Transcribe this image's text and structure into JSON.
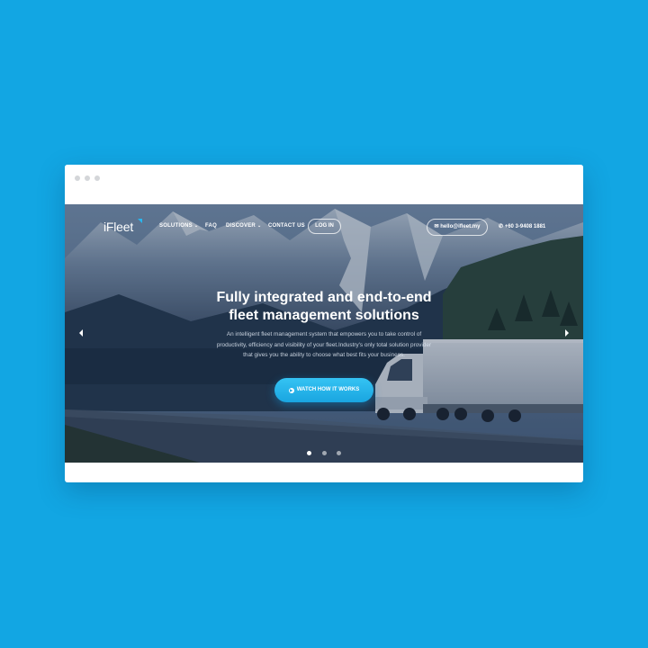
{
  "brand": {
    "logo_text": "iFleet",
    "accent_color": "#28b6f0",
    "background_color": "#12a6e3"
  },
  "nav": {
    "items": [
      {
        "label": "SOLUTIONS",
        "has_dropdown": true
      },
      {
        "label": "FAQ",
        "has_dropdown": false
      },
      {
        "label": "DISCOVER",
        "has_dropdown": true
      },
      {
        "label": "CONTACT US",
        "has_dropdown": false
      }
    ],
    "login_label": "LOG IN",
    "email": "hello@ifleet.my",
    "phone": "+60 3-9408 1881"
  },
  "hero": {
    "headline_line1": "Fully integrated and end-to-end",
    "headline_line2": "fleet management solutions",
    "subtext_line1": "An intelligent fleet management system that empowers you to take control of",
    "subtext_line2": "productivity, efficiency and visibility of your fleet.Industry's only total solution provider",
    "subtext_line3": "that gives you the ability to choose what best fits your business.",
    "cta_label": "WATCH HOW IT WORKS",
    "cta_icon": "play-icon"
  },
  "carousel": {
    "slide_count": 3,
    "active_index": 0
  }
}
